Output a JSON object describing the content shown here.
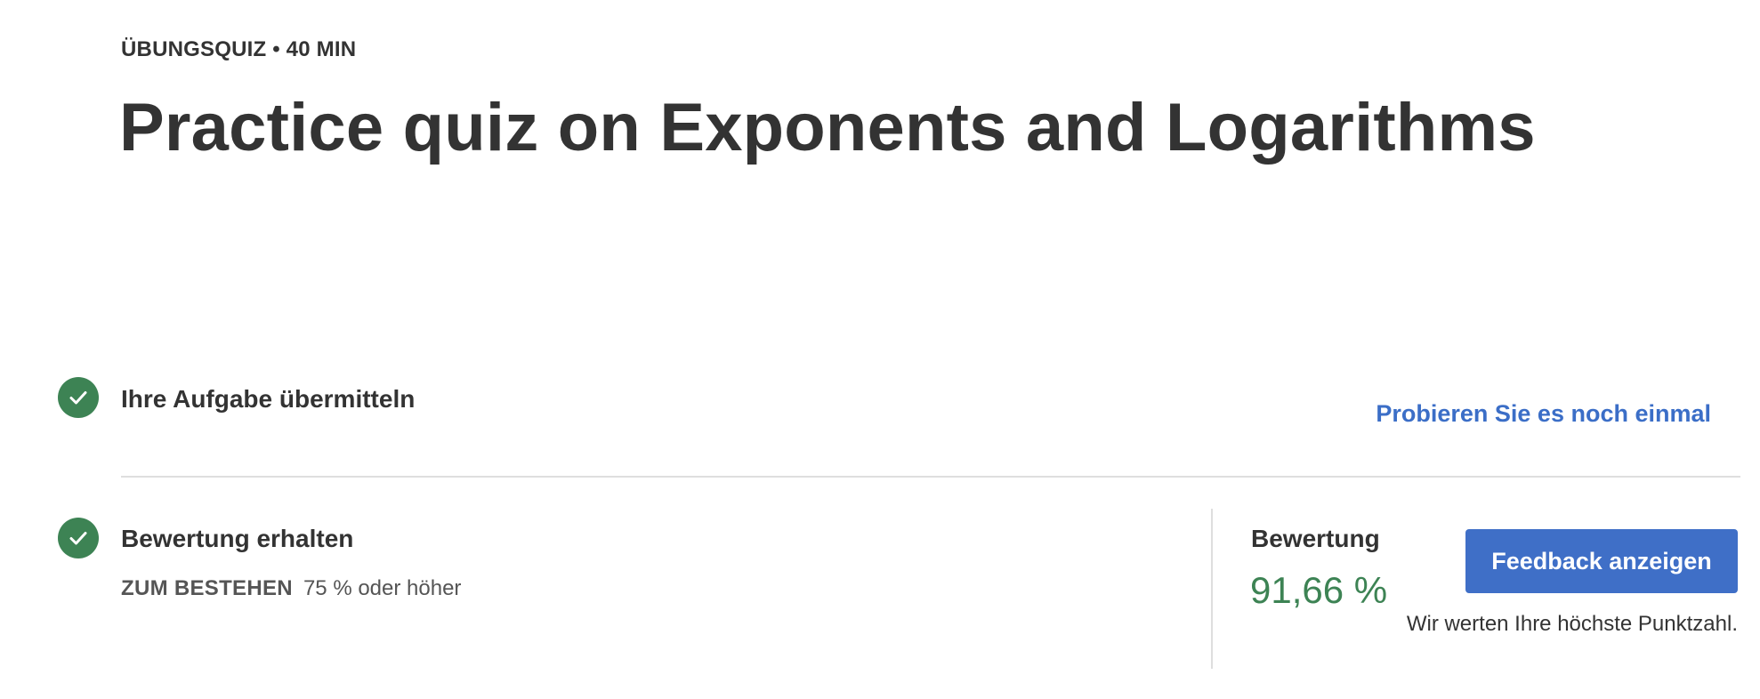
{
  "header": {
    "eyebrow": "ÜBUNGSQUIZ • 40 MIN",
    "title": "Practice quiz on Exponents and Logarithms"
  },
  "steps": [
    {
      "title": "Ihre Aufgabe übermitteln",
      "status": "complete",
      "icon": "check-icon"
    },
    {
      "title": "Bewertung erhalten",
      "status": "complete",
      "icon": "check-icon"
    }
  ],
  "retry": {
    "label": "Probieren Sie es noch einmal"
  },
  "requirement": {
    "label": "ZUM BESTEHEN",
    "value": "75 % oder höher"
  },
  "grade": {
    "label": "Bewertung",
    "value": "91,66 %",
    "note": "Wir werten Ihre höchste Punktzahl."
  },
  "feedback_button": {
    "label": "Feedback anzeigen"
  },
  "colors": {
    "success": "#3d8354",
    "link": "#3b6ec7",
    "button": "#3f6fc7",
    "text": "#333333"
  }
}
